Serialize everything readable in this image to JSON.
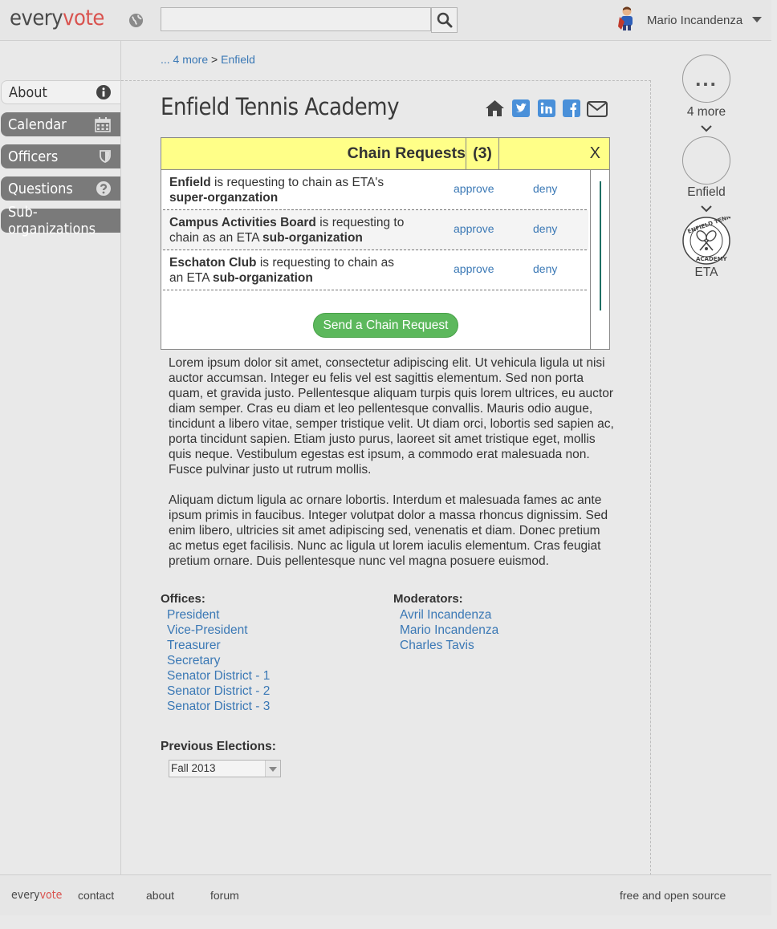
{
  "header": {
    "logo_every": "every",
    "logo_vote": "vote",
    "search_placeholder": "",
    "user_name": "Mario Incandenza"
  },
  "sidebar": {
    "items": [
      {
        "label": "About",
        "icon": "info-icon"
      },
      {
        "label": "Calendar",
        "icon": "calendar-icon"
      },
      {
        "label": "Officers",
        "icon": "shield-icon"
      },
      {
        "label": "Questions",
        "icon": "question-icon"
      },
      {
        "label": "Sub-organizations",
        "icon": ""
      }
    ]
  },
  "breadcrumb": {
    "more": "... 4 more",
    "separator": ">",
    "current": "Enfield"
  },
  "page": {
    "title": "Enfield Tennis Academy"
  },
  "modal": {
    "title": "Chain Requests",
    "count": "(3)",
    "close": "X",
    "requests": [
      {
        "org": "Enfield",
        "text": " is requesting to chain as ETA's ",
        "rel": "super-organzation",
        "approve": "approve",
        "deny": "deny"
      },
      {
        "org": "Campus Activities Board",
        "text": " is requesting to chain as an ETA ",
        "rel": "sub-organization",
        "approve": "approve",
        "deny": "deny"
      },
      {
        "org": "Eschaton Club",
        "text": " is requesting to chain as an ETA ",
        "rel": "sub-organization",
        "approve": "approve",
        "deny": "deny"
      }
    ],
    "send_label": "Send a Chain Request"
  },
  "content": {
    "paragraph1": "Lorem ipsum dolor sit amet, consectetur adipiscing elit. Ut vehicula ligula ut nisi auctor accumsan. Integer eu felis vel est sagittis elementum. Sed non porta quam, et gravida justo. Pellentesque aliquam turpis quis lorem ultrices, eu auctor diam semper. Cras eu diam et leo pellentesque convallis. Mauris odio augue, tincidunt a libero vitae, semper tristique velit. Ut diam orci, lobortis sed sapien ac, porta tincidunt sapien. Etiam justo purus, laoreet sit amet tristique eget, mollis quis neque. Vestibulum egestas est ipsum, a commodo erat malesuada non. Fusce pulvinar justo ut rutrum mollis.",
    "paragraph2": "Aliquam dictum ligula ac ornare lobortis. Interdum et malesuada fames ac ante ipsum primis in faucibus. Integer volutpat dolor a massa rhoncus dignissim. Sed enim libero, ultricies sit amet adipiscing sed, venenatis et diam. Donec pretium ac metus eget facilisis. Nunc ac ligula ut lorem iaculis elementum. Cras feugiat pretium ornare. Duis pellentesque nunc vel magna posuere euismod."
  },
  "offices": {
    "heading": "Offices:",
    "items": [
      "President",
      "Vice-President",
      "Treasurer",
      "Secretary",
      "Senator District - 1",
      "Senator District - 2",
      "Senator District - 3"
    ]
  },
  "moderators": {
    "heading": "Moderators:",
    "items": [
      "Avril Incandenza",
      "Mario Incandenza",
      "Charles Tavis"
    ]
  },
  "elections": {
    "heading": "Previous Elections:",
    "selected": "Fall 2013"
  },
  "org_chain": {
    "more_label": "4 more",
    "dots": "...",
    "parent_label": "Enfield",
    "current_label": "ETA",
    "seal_text": "ENFIELD TENNIS ACADEMY"
  },
  "footer": {
    "logo_every": "every",
    "logo_vote": "vote",
    "links": [
      "contact",
      "about",
      "forum"
    ],
    "right": "free and open source"
  },
  "colors": {
    "accent_red": "#d9534f",
    "link_blue": "#3a78b5",
    "modal_header": "#ffff88",
    "button_green": "#5cb85c",
    "sidebar_gray": "#7a7a7a",
    "share_blue": "#4a90d9"
  }
}
